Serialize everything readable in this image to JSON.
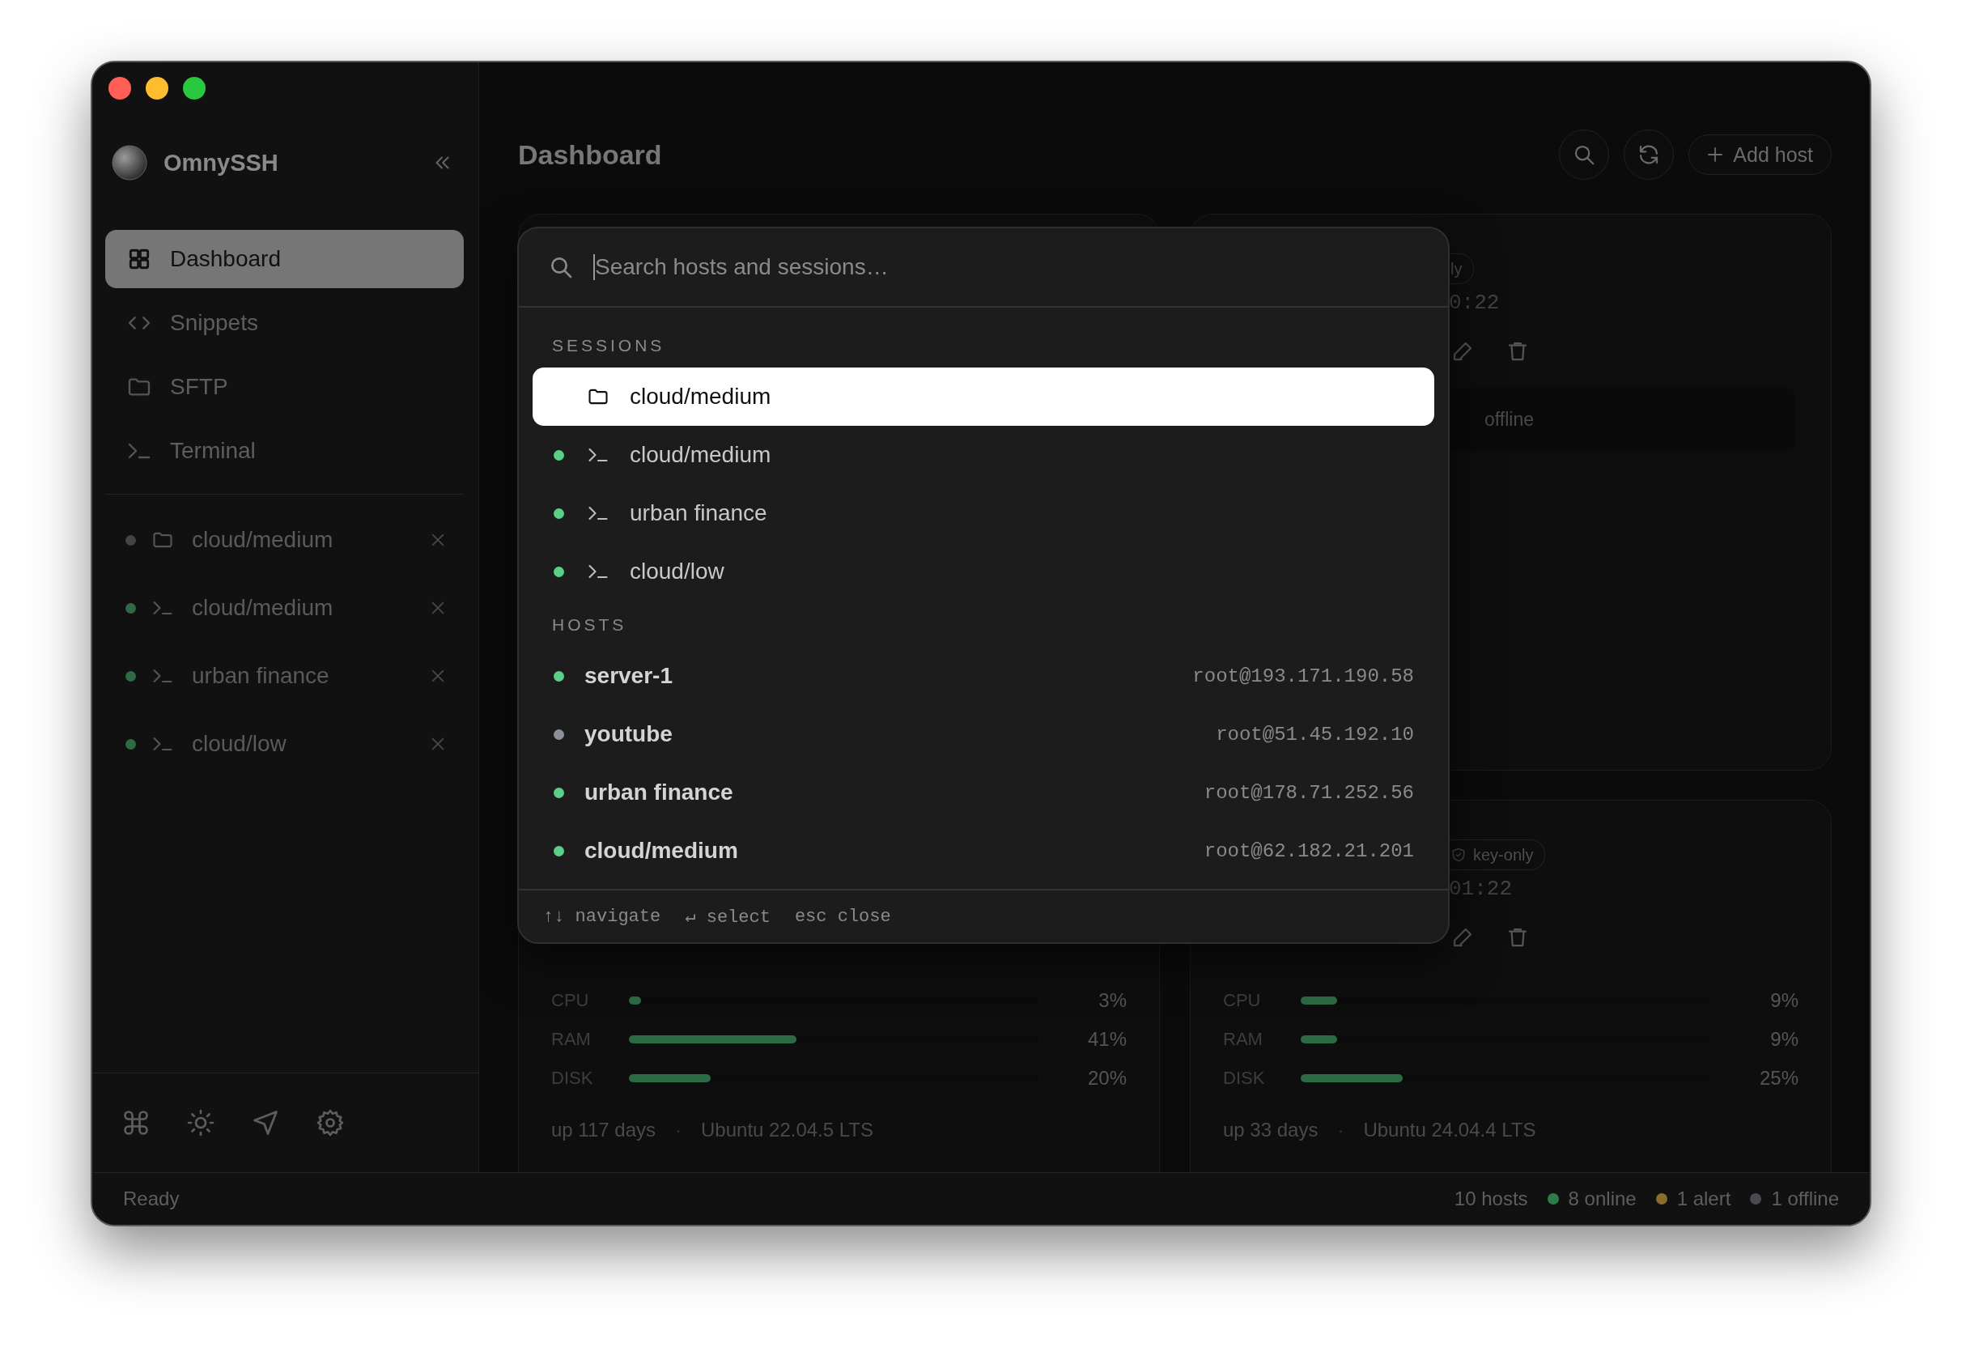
{
  "sidebar": {
    "app_name": "OmnySSH",
    "nav": [
      {
        "label": "Dashboard",
        "kind": "dashboard",
        "selected": true
      },
      {
        "label": "Snippets",
        "kind": "snippets",
        "selected": false
      },
      {
        "label": "SFTP",
        "kind": "sftp",
        "selected": false
      },
      {
        "label": "Terminal",
        "kind": "terminal",
        "selected": false
      }
    ],
    "sessions": [
      {
        "label": "cloud/medium",
        "kind": "sftp",
        "color": "#444444"
      },
      {
        "label": "cloud/medium",
        "kind": "terminal",
        "color": "#2e6b45"
      },
      {
        "label": "urban finance",
        "kind": "terminal",
        "color": "#2e6b45"
      },
      {
        "label": "cloud/low",
        "kind": "terminal",
        "color": "#2e6b45"
      }
    ]
  },
  "main": {
    "title": "Dashboard",
    "add_button": "Add host",
    "cards": [
      {
        "kind": "host"
      },
      {
        "kind": "host",
        "badge": {
          "text": "ly",
          "kind": "plain"
        },
        "time": "0:22",
        "actions": [
          {
            "kind": "edit"
          },
          {
            "kind": "delete"
          }
        ],
        "status_text": "offline"
      },
      {
        "kind": "host",
        "metrics": [
          {
            "label": "CPU",
            "level": 0.03,
            "reading": "3%"
          },
          {
            "label": "RAM",
            "level": 0.41,
            "reading": "41%"
          },
          {
            "label": "DISK",
            "level": 0.2,
            "reading": "20%"
          }
        ],
        "uptime": "up 117 days",
        "separator": "·",
        "os": "Ubuntu 22.04.5 LTS"
      },
      {
        "kind": "host",
        "badge": {
          "text": "key-only",
          "kind": "secured"
        },
        "time": "01:22",
        "actions": [
          {
            "kind": "edit"
          },
          {
            "kind": "delete"
          }
        ],
        "metrics": [
          {
            "label": "CPU",
            "level": 0.09,
            "reading": "9%"
          },
          {
            "label": "RAM",
            "level": 0.09,
            "reading": "9%"
          },
          {
            "label": "DISK",
            "level": 0.25,
            "reading": "25%"
          }
        ],
        "uptime": "up 33 days",
        "separator": "·",
        "os": "Ubuntu 24.04.4 LTS"
      }
    ]
  },
  "palette": {
    "placeholder": "Search hosts and sessions…",
    "sections": [
      {
        "title": "SESSIONS",
        "kind": "sessions",
        "items": [
          {
            "label": "cloud/medium",
            "kind": "sftp",
            "selected": true
          },
          {
            "label": "cloud/medium",
            "kind": "terminal",
            "color": "#5ccf86",
            "selected": false
          },
          {
            "label": "urban finance",
            "kind": "terminal",
            "color": "#5ccf86",
            "selected": false
          },
          {
            "label": "cloud/low",
            "kind": "terminal",
            "color": "#5ccf86",
            "selected": false
          }
        ]
      },
      {
        "title": "HOSTS",
        "kind": "hosts",
        "items": [
          {
            "label": "server-1",
            "address": "root@193.171.190.58",
            "color": "#5ccf86",
            "selected": false
          },
          {
            "label": "youtube",
            "address": "root@51.45.192.10",
            "color": "#8b8f98",
            "selected": false
          },
          {
            "label": "urban finance",
            "address": "root@178.71.252.56",
            "color": "#5ccf86",
            "selected": false
          },
          {
            "label": "cloud/medium",
            "address": "root@62.182.21.201",
            "color": "#5ccf86",
            "selected": false
          }
        ]
      }
    ],
    "hints": [
      "↑↓ navigate",
      "↵ select",
      "esc close"
    ]
  },
  "status_bar": {
    "text": "Ready",
    "stats": [
      {
        "label": "10 hosts"
      },
      {
        "label": "8 online",
        "color": "#2f7a4a"
      },
      {
        "label": "1 alert",
        "color": "#8a6d2c"
      },
      {
        "label": "1 offline",
        "color": "#4a4a50"
      }
    ]
  }
}
